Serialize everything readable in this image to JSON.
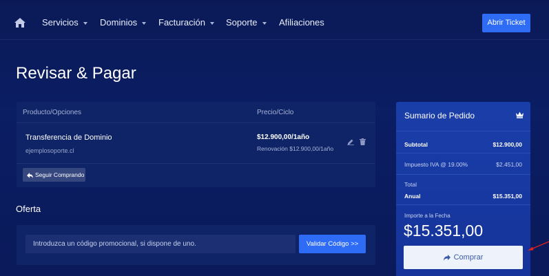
{
  "nav": {
    "home_icon": "home-icon",
    "items": [
      {
        "label": "Servicios",
        "has_caret": true
      },
      {
        "label": "Dominios",
        "has_caret": true
      },
      {
        "label": "Facturación",
        "has_caret": true
      },
      {
        "label": "Soporte",
        "has_caret": true
      },
      {
        "label": "Afiliaciones",
        "has_caret": false
      }
    ],
    "ticket_button": "Abrir Ticket"
  },
  "page": {
    "title": "Revisar & Pagar"
  },
  "cart": {
    "headers": {
      "product": "Producto/Opciones",
      "price": "Precio/Ciclo"
    },
    "items": [
      {
        "name": "Transferencia de Dominio",
        "domain": "ejemplosoporte.cl",
        "price": "$12.900,00/1año",
        "renewal": "Renovación $12.900,00/1año"
      }
    ],
    "continue_button": "Seguir Comprando"
  },
  "offer": {
    "title": "Oferta",
    "promo_placeholder": "Introduzca un código promocional, si dispone de uno.",
    "validate_button": "Validar Código >>"
  },
  "summary": {
    "title": "Sumario de Pedido",
    "subtotal_label": "Subtotal",
    "subtotal_value": "$12.900,00",
    "tax_label": "Impuesto IVA @ 19.00%",
    "tax_value": "$2.451,00",
    "total_label": "Total",
    "annual_label": "Anual",
    "annual_value": "$15.351,00",
    "due_today_label": "Importe a la Fecha",
    "due_today_value": "$15.351,00",
    "buy_button": "Comprar"
  },
  "colors": {
    "background": "#0b1a57",
    "panel": "#0e2466",
    "summary_panel": "#1a3ea9",
    "accent_button": "#2f6cf6",
    "buy_button_bg": "#eef3fb",
    "annotation_arrow": "#e0201b"
  }
}
